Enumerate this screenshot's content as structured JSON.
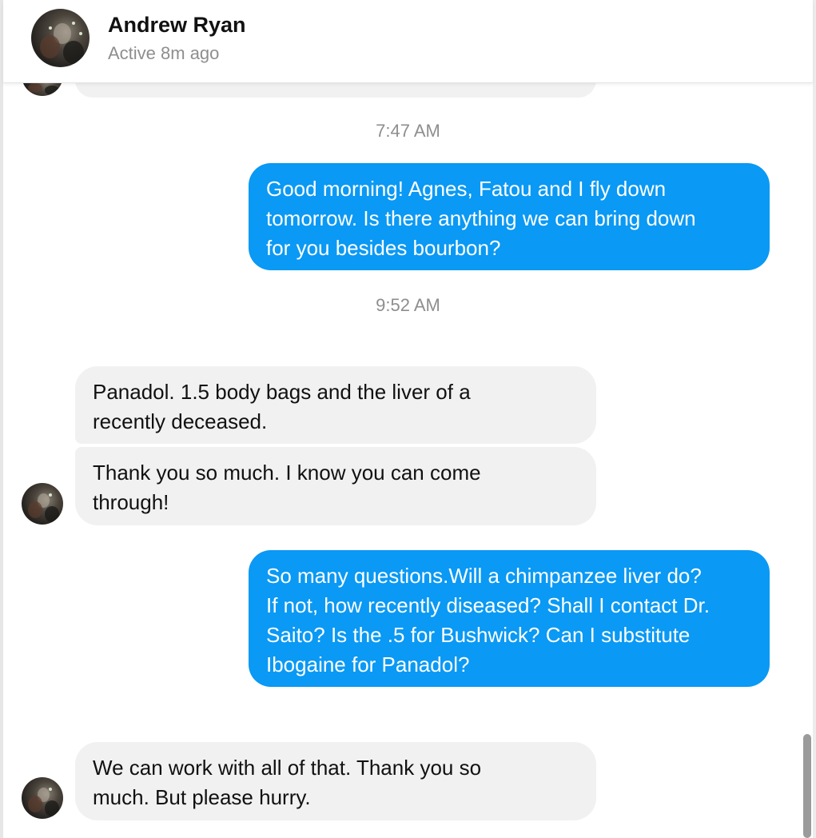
{
  "contact": {
    "name": "Andrew Ryan",
    "status": "Active 8m ago"
  },
  "timestamps": [
    "7:47 AM",
    "9:52 AM"
  ],
  "messages": [
    {
      "sender": "me",
      "text": "Good morning! Agnes, Fatou and I fly down\ntomorrow. Is there anything we can bring down\nfor you besides bourbon?"
    },
    {
      "sender": "contact",
      "text": "Panadol. 1.5 body bags and the liver of a\nrecently deceased."
    },
    {
      "sender": "contact",
      "text": "Thank you so much. I know you can come\nthrough!"
    },
    {
      "sender": "me",
      "text": "So many questions.Will a chimpanzee liver do?\nIf not, how recently diseased? Shall I contact Dr.\nSaito? Is the .5 for Bushwick? Can I substitute\nIbogaine for Panadol?"
    },
    {
      "sender": "contact",
      "text": "We can work with all of that. Thank you so\nmuch. But please hurry."
    }
  ],
  "colors": {
    "outgoing_bubble": "#0a99f4",
    "incoming_bubble": "#f1f1f1",
    "timestamp_text": "#8e8e8e"
  }
}
